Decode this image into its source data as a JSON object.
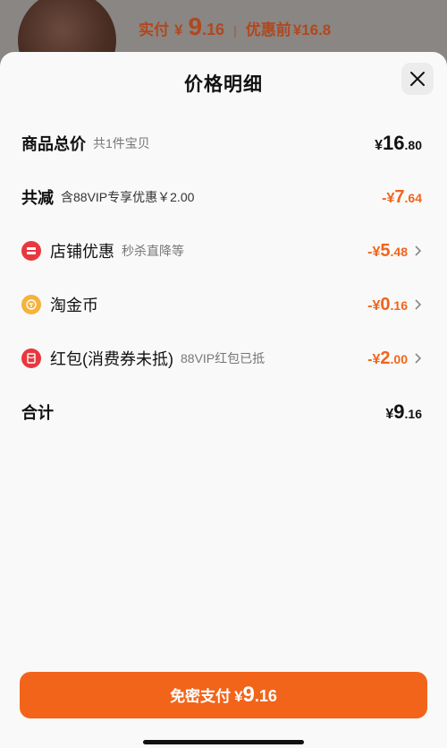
{
  "background": {
    "price_label": "实付",
    "currency": "¥",
    "price_int": "9",
    "price_dec": ".16",
    "separator": "|",
    "orig_label": "优惠前",
    "orig_price": "¥16.8"
  },
  "sheet": {
    "title": "价格明细",
    "close_icon": "close-icon"
  },
  "rows": {
    "total": {
      "label": "商品总价",
      "note": "共1件宝贝",
      "yen": "¥",
      "int": "16",
      "dec": ".80"
    },
    "reduction": {
      "label": "共减",
      "note": "含88VIP专享优惠￥2.00",
      "yen": "-¥",
      "int": "7",
      "dec": ".64"
    },
    "shop_discount": {
      "icon": "shop-discount-icon",
      "label": "店铺优惠",
      "note": "秒杀直降等",
      "yen": "-¥",
      "int": "5",
      "dec": ".48"
    },
    "taojinbi": {
      "icon": "coin-icon",
      "label": "淘金币",
      "yen": "-¥",
      "int": "0",
      "dec": ".16"
    },
    "red_packet": {
      "icon": "red-packet-icon",
      "label": "红包(消费券未抵)",
      "note": "88VIP红包已抵",
      "yen": "-¥",
      "int": "2",
      "dec": ".00"
    },
    "sum": {
      "label": "合计",
      "yen": "¥",
      "int": "9",
      "dec": ".16"
    }
  },
  "pay_button": {
    "label": "免密支付",
    "yen": "¥",
    "int": "9",
    "dec": ".16"
  },
  "colors": {
    "accent": "#f2641a",
    "shop_icon": "#e8373f",
    "coin_icon": "#f5b23d"
  }
}
